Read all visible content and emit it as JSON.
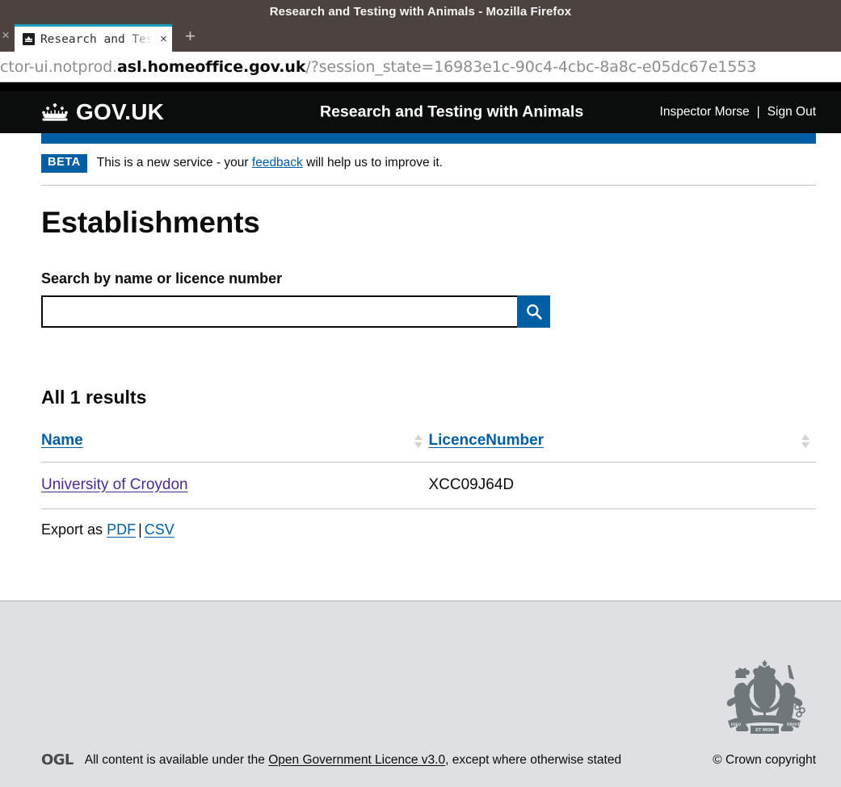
{
  "browser": {
    "window_title": "Research and Testing with Animals - Mozilla Firefox",
    "tab_title": "Research and Tes",
    "tab_close_label": "×",
    "prev_tab_close_label": "×",
    "new_tab_label": "+",
    "url_prefix": "ctor-ui.notprod.",
    "url_host": "asl.homeoffice.gov.uk",
    "url_suffix": "/?session_state=16983e1c-90c4-4cbc-8a8c-e05dc67e1553"
  },
  "header": {
    "brand": "GOV.UK",
    "service_name": "Research and Testing with Animals",
    "user_name": "Inspector Morse",
    "separator": "|",
    "sign_out": "Sign Out",
    "background": "#0b0c0c",
    "navbar_color": "#005ea5"
  },
  "phase_banner": {
    "tag": "BETA",
    "text_before": "This is a new service - your",
    "link": "feedback",
    "text_after": "will help us to improve it."
  },
  "main": {
    "page_title": "Establishments",
    "search_label": "Search by name or licence number",
    "search_value": "",
    "search_placeholder": "",
    "search_button_icon": "search-icon",
    "results_count": "All 1 results"
  },
  "table": {
    "columns": [
      {
        "label": "Name",
        "sortable": true
      },
      {
        "label": "LicenceNumber",
        "sortable": true
      }
    ],
    "rows": [
      {
        "name": "University of Croydon",
        "licence_number": "XCC09J64D"
      }
    ]
  },
  "export": {
    "label": "Export as",
    "pdf": "PDF",
    "separator": "|",
    "csv": "CSV"
  },
  "footer": {
    "ogl_logo": "OGL",
    "licence_before": "All content is available under the",
    "licence_link": "Open Government Licence v3.0",
    "licence_after": ", except where otherwise stated",
    "copyright": "© Crown copyright",
    "background": "#dee0e2"
  },
  "colors": {
    "govuk_blue": "#005ea5",
    "link_blue": "#005ea5",
    "visited_purple": "#4c2c92",
    "black": "#0b0c0c",
    "grey_border": "#bfc1c3"
  }
}
